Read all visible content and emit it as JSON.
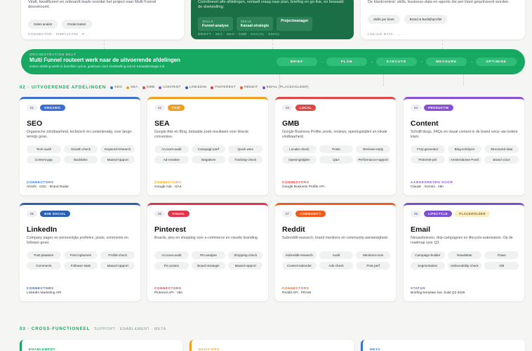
{
  "top": {
    "left": {
      "text": "Vindt, kwalificeert en onboardt leads voordat het project naar Multi Funnel doorstroomt.",
      "pills": [
        "Sales analist",
        "Onderzoeker"
      ],
      "footer": "CONNECTOR · SIMPLICATE · P..."
    },
    "center": {
      "text": "Coördineert alle afdelingen, vertaalt vraag naar plan, briefing en go-live, en bewaakt de doelstelling.",
      "skills": [
        {
          "label": "SKILLS",
          "value": "Funnel-analyse"
        },
        {
          "label": "SKILLS",
          "value": "Kanaal-strategie"
        },
        {
          "label": "",
          "value": "Projectmanager"
        }
      ],
      "footer": "BRIEFT · SEA · SEO · GMB · SOCIAL · EMAIL"
    },
    "right": {
      "text": "De klantcontext: skills, business-data en agents die per klant geactiveerd worden.",
      "pills": [
        "Skills per klant",
        "Brand & Bedrijfsprofiel"
      ],
      "footer": "LOKALE DATA · ..."
    }
  },
  "belt": {
    "label": "ORCHESTRATION BELT",
    "title": "Multi Funnel routeert werk naar de uitvoerende afdelingen",
    "subtitle": "Iedere afdeling werkt in dezelfde cyclus, gedreven door Doelstelling.md en Kanaalstrategie.md",
    "steps": [
      "BRIEF",
      "PLAN",
      "EXECUTE",
      "MEASURE",
      "OPTIMISE"
    ],
    "arrow": "→"
  },
  "section2": {
    "title": "02 · UITVOERENDE AFDELINGEN",
    "legend": [
      {
        "label": "SEO",
        "color": "#3b6fd4"
      },
      {
        "label": "SEA",
        "color": "#f0a020"
      },
      {
        "label": "GMB",
        "color": "#e04646"
      },
      {
        "label": "CONTENT",
        "color": "#8a4fd8"
      },
      {
        "label": "LINKEDIN",
        "color": "#2a5fb0"
      },
      {
        "label": "PINTEREST",
        "color": "#e0344a"
      },
      {
        "label": "REDDIT",
        "color": "#f05a1a"
      },
      {
        "label": "EMAIL (PLACEHOLDER)",
        "color": "#7a4fd0"
      }
    ]
  },
  "cards": [
    {
      "num": "01",
      "tag": "ORGANIC",
      "color": "#3b6fd4",
      "title": "SEO",
      "desc": "Organische zichtbaarheid, technisch én contentmatig, voor lange-termijn groei.",
      "chips": [
        "Tech-audit",
        "Growth check",
        "Keyword-research",
        "Content gap",
        "Backlinks",
        "Maand-rapport"
      ],
      "conn_label": "CONNECTORS",
      "conn_value": "Ahrefs · GSC · Brand Radar"
    },
    {
      "num": "02",
      "tag": "PAID",
      "color": "#f0a020",
      "title": "SEA",
      "desc": "Google Ads en Bing, betaalde zoek-resultaten voor directe conversies.",
      "chips": [
        "Account-audit",
        "Campaign-perf",
        "Quick wins",
        "Ad-creative",
        "Negatives",
        "Tracking-check"
      ],
      "conn_label": "CONNECTORS",
      "conn_value": "Google Ads · GA4"
    },
    {
      "num": "03",
      "tag": "LOCAL",
      "color": "#e04646",
      "title": "GMB",
      "desc": "Google Business Profile: posts, reviews, openingstijden en lokale vindbaarheid.",
      "chips": [
        "Locatie-check",
        "Posts",
        "Reviews-reply",
        "Openingstijden",
        "Q&A",
        "Performance-rapport"
      ],
      "conn_label": "CONNECTORS",
      "conn_value": "Google Business Profile API"
    },
    {
      "num": "04",
      "tag": "PRODUCTIE",
      "color": "#8a4fd8",
      "title": "Content",
      "desc": "Schrijft blogs, FAQs en visual content in de brand voice van iedere klant.",
      "chips": [
        "FAQ-generator",
        "Blog-schrijven",
        "Structured data",
        "Pinterest-pin",
        "Amsterdamse Poort",
        "Brand voice"
      ],
      "conn_label": "AANGEDREVEN DOOR",
      "conn_value": "Claude · Gemini · n8n"
    },
    {
      "num": "05",
      "tag": "B2B SOCIAL",
      "color": "#2a5fb0",
      "title": "LinkedIn",
      "desc": "Company pages en persoonlijke profielen, posts, comments en follower-groei.",
      "chips": [
        "Post plaatsen",
        "Post inplannen",
        "Profiel-check",
        "Comments",
        "Follower-stats",
        "Maand-rapport"
      ],
      "conn_label": "CONNECTORS",
      "conn_value": "LinkedIn Marketing API"
    },
    {
      "num": "06",
      "tag": "VISUAL",
      "color": "#e0344a",
      "title": "Pinterest",
      "desc": "Boards, pins en shopping voor e-commerce en visuele branding.",
      "chips": [
        "Account-audit",
        "Pin-analyse",
        "Shopping-check",
        "Pin posten",
        "Board-strategie",
        "Maand-rapport"
      ],
      "conn_label": "CONNECTORS",
      "conn_value": "Pinterest API · n8n"
    },
    {
      "num": "07",
      "tag": "COMMUNITY",
      "color": "#f05a1a",
      "title": "Reddit",
      "desc": "Subreddit-research, brand mentions en community-aanwezigheid.",
      "chips": [
        "Subreddit-research",
        "Audit",
        "Mentions-mon",
        "Content-kalender",
        "Ads-check",
        "Post-perf"
      ],
      "conn_label": "CONNECTORS",
      "conn_value": "Reddit API · PRAW"
    },
    {
      "num": "08",
      "tag": "LIFECYCLE",
      "color": "#7a4fd0",
      "placeholder": "PLACEHOLDER",
      "title": "Email",
      "desc": "Nieuwsbrieven, drip-campagnes en lifecycle-automation. Op de roadmap voor Q3.",
      "chips": [
        "Campaign-builder",
        "Newsletter",
        "Flows",
        "Segmentation",
        "Deliverability-check",
        "A/B"
      ],
      "conn_label": "STATUS",
      "conn_value": "Briefing-template live, build Q3 2026"
    }
  ],
  "section3": {
    "title": "03 · CROSS-FUNCTIONEEL",
    "tail": "SUPPORT · ENABLEMENT · META"
  },
  "bottom": [
    {
      "label": "ENABLEMENT",
      "color": "#17a862"
    },
    {
      "label": "DAILY OPS",
      "color": "#f0a020"
    },
    {
      "label": "META",
      "color": "#3b6fd4"
    }
  ]
}
